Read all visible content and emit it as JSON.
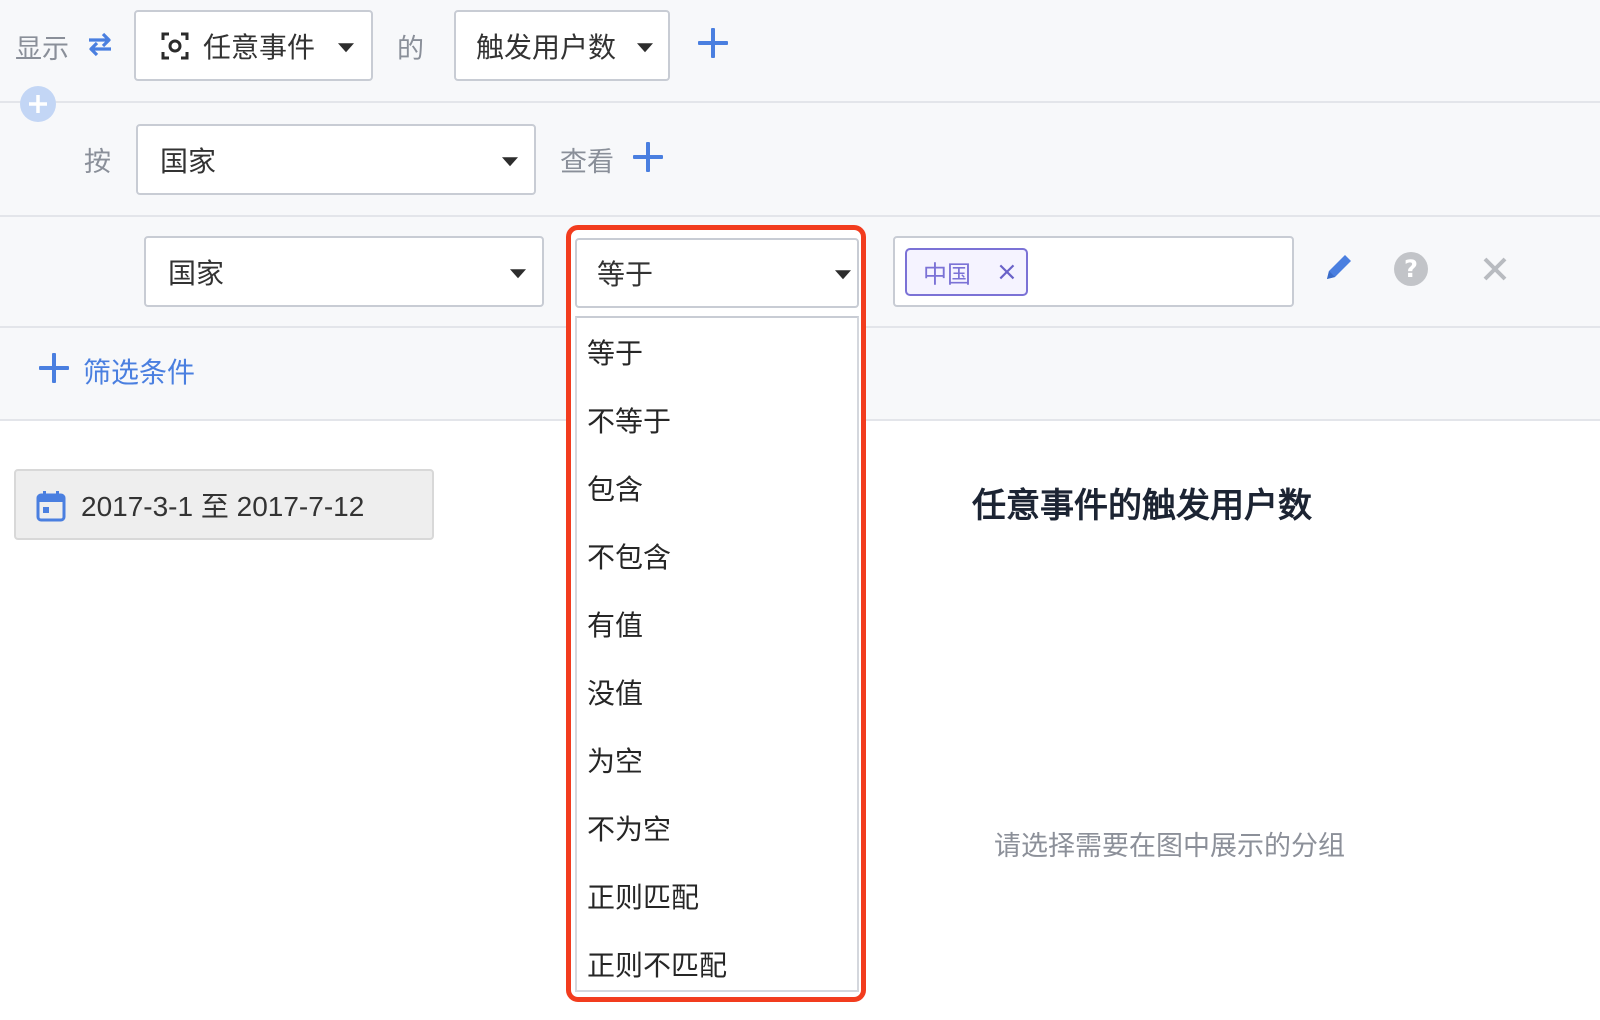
{
  "row1": {
    "show_label": "显示",
    "event_select": "任意事件",
    "of_label": "的",
    "metric_select": "触发用户数"
  },
  "row2": {
    "by_label": "按",
    "group_select": "国家",
    "view_label": "查看"
  },
  "filter": {
    "property_select": "国家",
    "operator_select": "等于",
    "value_chip": "中国",
    "chip_remove": "×"
  },
  "add_filter_label": "筛选条件",
  "operator_options": [
    "等于",
    "不等于",
    "包含",
    "不包含",
    "有值",
    "没值",
    "为空",
    "不为空",
    "正则匹配",
    "正则不匹配"
  ],
  "date_range": "2017-3-1 至 2017-7-12",
  "chart_title": "任意事件的触发用户数",
  "empty_hint": "请选择需要在图中展示的分组",
  "colors": {
    "accent": "#4a7fe0",
    "highlight_border": "#f23c1e",
    "chip": "#7b72d6"
  }
}
